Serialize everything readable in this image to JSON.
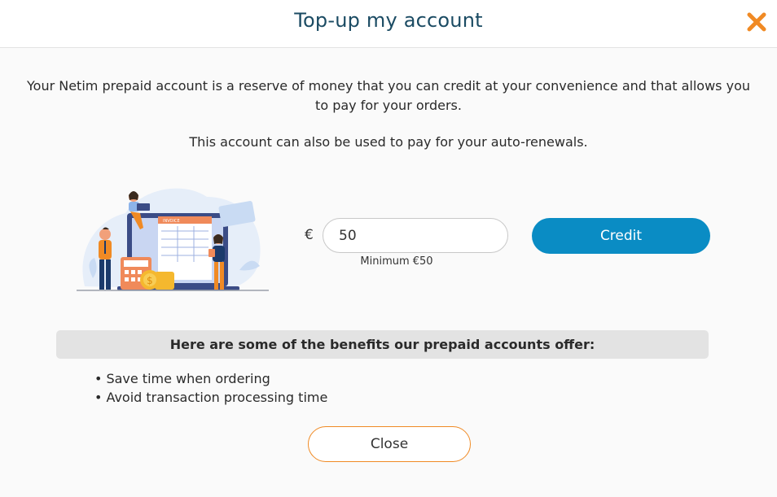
{
  "modal": {
    "title": "Top-up my account",
    "close_icon": "close-icon"
  },
  "intro": {
    "paragraph1": "Your Netim prepaid account is a reserve of money that you can credit at your convenience and that allows you to pay for your orders.",
    "paragraph2": "This account can also be used to pay for your auto-renewals."
  },
  "illustration": {
    "invoice_label": "INVOICE",
    "icon": "invoice-illustration"
  },
  "topup": {
    "currency_symbol": "€",
    "amount_value": "50",
    "minimum_label": "Minimum €50",
    "credit_label": "Credit"
  },
  "benefits": {
    "title": "Here are some of the benefits our prepaid accounts offer:",
    "items": [
      "Save time when ordering",
      "Avoid transaction processing time"
    ]
  },
  "footer": {
    "close_label": "Close"
  },
  "colors": {
    "title": "#1b4b63",
    "accent_orange": "#f08a24",
    "credit_button": "#0a8cc4",
    "benefits_bar": "#e3e3e3"
  }
}
